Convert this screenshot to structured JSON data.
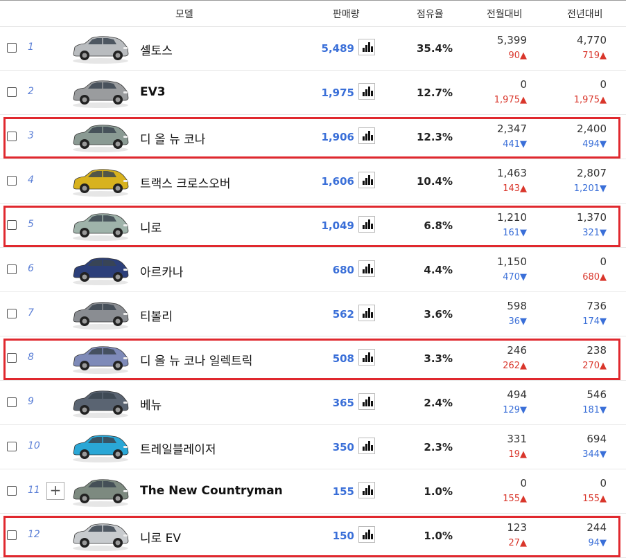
{
  "header": {
    "model": "모델",
    "sales": "판매량",
    "share": "점유율",
    "mom": "전월대비",
    "yoy": "전년대비"
  },
  "rows": [
    {
      "rank": "1",
      "name": "셀토스",
      "sales": "5,489",
      "share": "35.4%",
      "mom": "5,399",
      "mom_delta": "90",
      "mom_dir": "up",
      "yoy": "4,770",
      "yoy_delta": "719",
      "yoy_dir": "up",
      "car_color": "#b9bcbf",
      "highlight": false
    },
    {
      "rank": "2",
      "name": "EV3",
      "sales": "1,975",
      "share": "12.7%",
      "mom": "0",
      "mom_delta": "1,975",
      "mom_dir": "up",
      "yoy": "0",
      "yoy_delta": "1,975",
      "yoy_dir": "up",
      "car_color": "#9a9c9e",
      "highlight": false
    },
    {
      "rank": "3",
      "name": "디 올 뉴 코나",
      "sales": "1,906",
      "share": "12.3%",
      "mom": "2,347",
      "mom_delta": "441",
      "mom_dir": "down",
      "yoy": "2,400",
      "yoy_delta": "494",
      "yoy_dir": "down",
      "car_color": "#8a9a93",
      "highlight": true
    },
    {
      "rank": "4",
      "name": "트랙스 크로스오버",
      "sales": "1,606",
      "share": "10.4%",
      "mom": "1,463",
      "mom_delta": "143",
      "mom_dir": "up",
      "yoy": "2,807",
      "yoy_delta": "1,201",
      "yoy_dir": "down",
      "car_color": "#d8b21e",
      "highlight": false
    },
    {
      "rank": "5",
      "name": "니로",
      "sales": "1,049",
      "share": "6.8%",
      "mom": "1,210",
      "mom_delta": "161",
      "mom_dir": "down",
      "yoy": "1,370",
      "yoy_delta": "321",
      "yoy_dir": "down",
      "car_color": "#9fb3aa",
      "highlight": true
    },
    {
      "rank": "6",
      "name": "아르카나",
      "sales": "680",
      "share": "4.4%",
      "mom": "1,150",
      "mom_delta": "470",
      "mom_dir": "down",
      "yoy": "0",
      "yoy_delta": "680",
      "yoy_dir": "up",
      "car_color": "#2c3f7a",
      "highlight": false
    },
    {
      "rank": "7",
      "name": "티볼리",
      "sales": "562",
      "share": "3.6%",
      "mom": "598",
      "mom_delta": "36",
      "mom_dir": "down",
      "yoy": "736",
      "yoy_delta": "174",
      "yoy_dir": "down",
      "car_color": "#8a8d92",
      "highlight": false
    },
    {
      "rank": "8",
      "name": "디 올 뉴 코나 일렉트릭",
      "sales": "508",
      "share": "3.3%",
      "mom": "246",
      "mom_delta": "262",
      "mom_dir": "up",
      "yoy": "238",
      "yoy_delta": "270",
      "yoy_dir": "up",
      "car_color": "#7e8ab8",
      "highlight": true
    },
    {
      "rank": "9",
      "name": "베뉴",
      "sales": "365",
      "share": "2.4%",
      "mom": "494",
      "mom_delta": "129",
      "mom_dir": "down",
      "yoy": "546",
      "yoy_delta": "181",
      "yoy_dir": "down",
      "car_color": "#5a6472",
      "highlight": false
    },
    {
      "rank": "10",
      "name": "트레일블레이저",
      "sales": "350",
      "share": "2.3%",
      "mom": "331",
      "mom_delta": "19",
      "mom_dir": "up",
      "yoy": "694",
      "yoy_delta": "344",
      "yoy_dir": "down",
      "car_color": "#2aa7d6",
      "highlight": false
    },
    {
      "rank": "11",
      "name": "The New Countryman",
      "sales": "155",
      "share": "1.0%",
      "mom": "0",
      "mom_delta": "155",
      "mom_dir": "up",
      "yoy": "0",
      "yoy_delta": "155",
      "yoy_dir": "up",
      "car_color": "#7d8a80",
      "highlight": false,
      "expand": "+"
    },
    {
      "rank": "12",
      "name": "니로 EV",
      "sales": "150",
      "share": "1.0%",
      "mom": "123",
      "mom_delta": "27",
      "mom_dir": "up",
      "yoy": "244",
      "yoy_delta": "94",
      "yoy_dir": "down",
      "car_color": "#c8cbce",
      "highlight": true
    }
  ],
  "colors": {
    "up": "#d9362b",
    "down": "#3a6fd8",
    "highlight": "#e0282e",
    "sales": "#3a6fd8"
  },
  "icons": {
    "up": "▲",
    "down": "▼",
    "chart": "bar-chart-icon",
    "expand": "plus-icon"
  }
}
